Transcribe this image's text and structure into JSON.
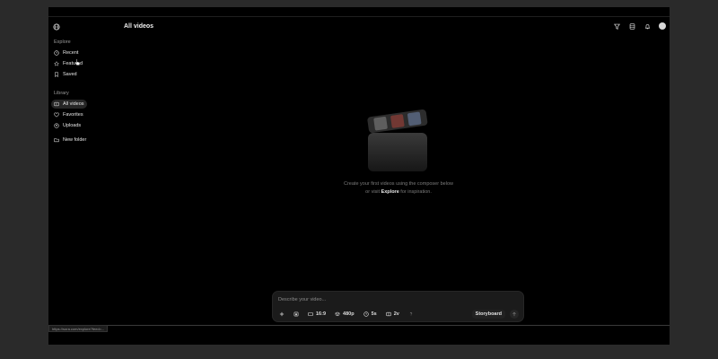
{
  "header": {
    "title": "All videos"
  },
  "sidebar": {
    "sections": [
      {
        "label": "Explore",
        "items": [
          {
            "label": "Recent",
            "icon": "clock-icon"
          },
          {
            "label": "Featured",
            "icon": "star-icon"
          },
          {
            "label": "Saved",
            "icon": "bookmark-icon"
          }
        ]
      },
      {
        "label": "Library",
        "items": [
          {
            "label": "All videos",
            "icon": "video-library-icon",
            "active": true
          },
          {
            "label": "Favorites",
            "icon": "heart-icon"
          },
          {
            "label": "Uploads",
            "icon": "upload-icon"
          }
        ]
      }
    ],
    "new_folder": "New folder"
  },
  "empty_state": {
    "line1": "Create your first videos using the composer below",
    "line2_prefix": "or visit",
    "line2_link": "Explore",
    "line2_suffix": "for inspiration."
  },
  "composer": {
    "placeholder": "Describe your video...",
    "aspect": "16:9",
    "resolution": "480p",
    "duration": "5s",
    "variations": "2v",
    "storyboard_label": "Storyboard"
  },
  "status_bar": {
    "url": "https://sora.com/explore?feed=..."
  },
  "colors": {
    "background": "#000000",
    "panel": "#1b1b1b",
    "text": "#e8e8e8"
  }
}
